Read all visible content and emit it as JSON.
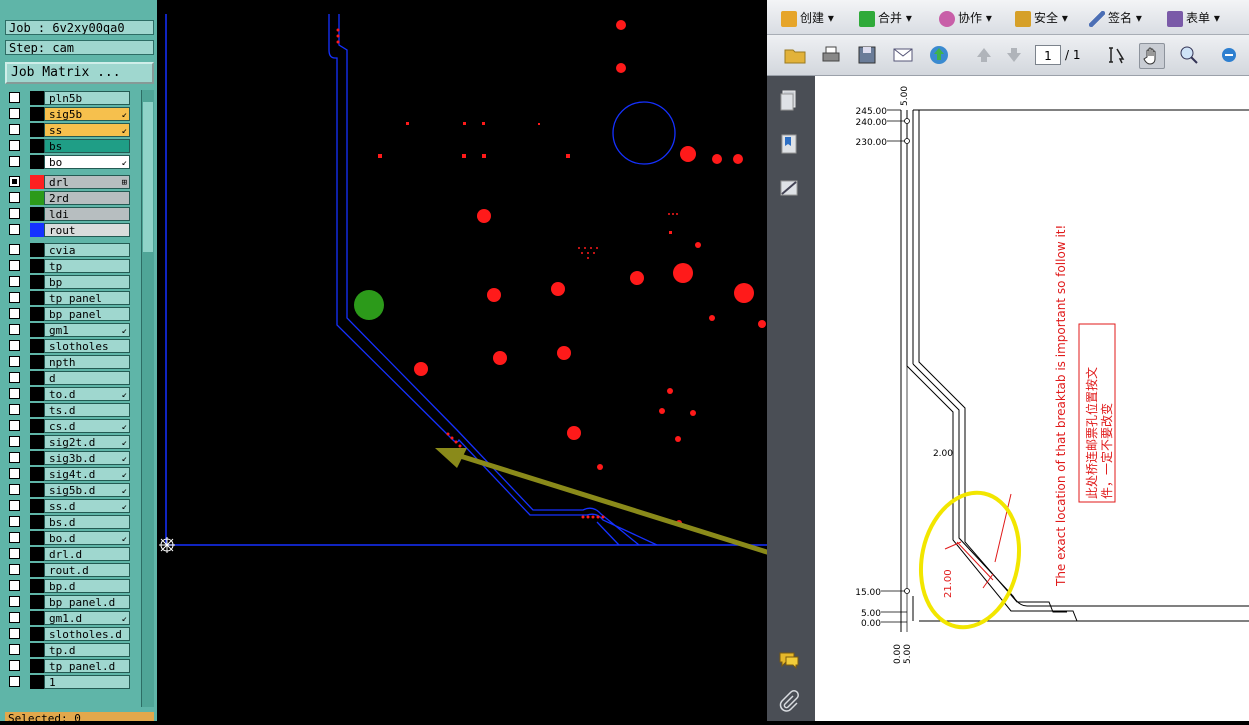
{
  "cam": {
    "job_line": "Job : 6v2xy00qa0",
    "step_line": "Step: cam",
    "job_matrix_label": "Job Matrix ...",
    "bottom_status": "Selected: 0",
    "layers": [
      {
        "name": "pln5b",
        "checked": false,
        "swatch": "#000000",
        "bg": "#9fd7cf",
        "mark": ""
      },
      {
        "name": "sig5b",
        "checked": false,
        "swatch": "#000000",
        "bg": "#f6c04d",
        "mark": "↙"
      },
      {
        "name": "ss",
        "checked": false,
        "swatch": "#000000",
        "bg": "#f6c04d",
        "mark": "↙"
      },
      {
        "name": "bs",
        "checked": false,
        "swatch": "#000000",
        "bg": "#1f9e86",
        "mark": ""
      },
      {
        "name": "bo",
        "checked": false,
        "swatch": "#000000",
        "bg": "#ffffff",
        "mark": "↙"
      },
      {
        "name": "drl",
        "checked": true,
        "swatch": "#ff2020",
        "bg": "#b7bec0",
        "mark": "⊞",
        "gap": true
      },
      {
        "name": "2rd",
        "checked": false,
        "swatch": "#2c9a1a",
        "bg": "#b7bec0",
        "mark": ""
      },
      {
        "name": "ldi",
        "checked": false,
        "swatch": "#000000",
        "bg": "#b7bec0",
        "mark": ""
      },
      {
        "name": "rout",
        "checked": false,
        "swatch": "#1531ff",
        "bg": "#d9dcdc",
        "mark": ""
      },
      {
        "name": "cvia",
        "checked": false,
        "swatch": "#000000",
        "bg": "#9fd7cf",
        "mark": "",
        "gap": true
      },
      {
        "name": "tp",
        "checked": false,
        "swatch": "#000000",
        "bg": "#9fd7cf",
        "mark": ""
      },
      {
        "name": "bp",
        "checked": false,
        "swatch": "#000000",
        "bg": "#9fd7cf",
        "mark": ""
      },
      {
        "name": "tp_panel",
        "checked": false,
        "swatch": "#000000",
        "bg": "#9fd7cf",
        "mark": ""
      },
      {
        "name": "bp_panel",
        "checked": false,
        "swatch": "#000000",
        "bg": "#9fd7cf",
        "mark": ""
      },
      {
        "name": "gm1",
        "checked": false,
        "swatch": "#000000",
        "bg": "#9fd7cf",
        "mark": "↙"
      },
      {
        "name": "slotholes",
        "checked": false,
        "swatch": "#000000",
        "bg": "#9fd7cf",
        "mark": ""
      },
      {
        "name": "npth",
        "checked": false,
        "swatch": "#000000",
        "bg": "#9fd7cf",
        "mark": ""
      },
      {
        "name": "d",
        "checked": false,
        "swatch": "#000000",
        "bg": "#9fd7cf",
        "mark": ""
      },
      {
        "name": "to.d",
        "checked": false,
        "swatch": "#000000",
        "bg": "#9fd7cf",
        "mark": "↙"
      },
      {
        "name": "ts.d",
        "checked": false,
        "swatch": "#000000",
        "bg": "#9fd7cf",
        "mark": ""
      },
      {
        "name": "cs.d",
        "checked": false,
        "swatch": "#000000",
        "bg": "#9fd7cf",
        "mark": "↙"
      },
      {
        "name": "sig2t.d",
        "checked": false,
        "swatch": "#000000",
        "bg": "#9fd7cf",
        "mark": "↙"
      },
      {
        "name": "sig3b.d",
        "checked": false,
        "swatch": "#000000",
        "bg": "#9fd7cf",
        "mark": "↙"
      },
      {
        "name": "sig4t.d",
        "checked": false,
        "swatch": "#000000",
        "bg": "#9fd7cf",
        "mark": "↙"
      },
      {
        "name": "sig5b.d",
        "checked": false,
        "swatch": "#000000",
        "bg": "#9fd7cf",
        "mark": "↙"
      },
      {
        "name": "ss.d",
        "checked": false,
        "swatch": "#000000",
        "bg": "#9fd7cf",
        "mark": "↙"
      },
      {
        "name": "bs.d",
        "checked": false,
        "swatch": "#000000",
        "bg": "#9fd7cf",
        "mark": ""
      },
      {
        "name": "bo.d",
        "checked": false,
        "swatch": "#000000",
        "bg": "#9fd7cf",
        "mark": "↙"
      },
      {
        "name": "drl.d",
        "checked": false,
        "swatch": "#000000",
        "bg": "#9fd7cf",
        "mark": ""
      },
      {
        "name": "rout.d",
        "checked": false,
        "swatch": "#000000",
        "bg": "#9fd7cf",
        "mark": ""
      },
      {
        "name": "bp.d",
        "checked": false,
        "swatch": "#000000",
        "bg": "#9fd7cf",
        "mark": ""
      },
      {
        "name": "bp_panel.d",
        "checked": false,
        "swatch": "#000000",
        "bg": "#9fd7cf",
        "mark": ""
      },
      {
        "name": "gm1.d",
        "checked": false,
        "swatch": "#000000",
        "bg": "#9fd7cf",
        "mark": "↙"
      },
      {
        "name": "slotholes.d",
        "checked": false,
        "swatch": "#000000",
        "bg": "#9fd7cf",
        "mark": ""
      },
      {
        "name": "tp.d",
        "checked": false,
        "swatch": "#000000",
        "bg": "#9fd7cf",
        "mark": ""
      },
      {
        "name": "tp_panel.d",
        "checked": false,
        "swatch": "#000000",
        "bg": "#9fd7cf",
        "mark": ""
      },
      {
        "name": "1",
        "checked": false,
        "swatch": "#000000",
        "bg": "#9fd7cf",
        "mark": ""
      }
    ]
  },
  "pdf": {
    "toolbar": {
      "create": "创建",
      "merge": "合并",
      "collaborate": "协作",
      "secure": "安全",
      "sign": "签名",
      "forms": "表单"
    },
    "page_number": "1",
    "page_total": "/ 1",
    "drawing": {
      "y_labels": [
        "245.00",
        "240.00",
        "230.00",
        "2.00",
        "15.00",
        "5.00",
        "0.00"
      ],
      "x_labels": [
        "0.00",
        "5.00"
      ],
      "top_label": "5.00",
      "dim_label": "21.00",
      "note_en": "The exact location of that breaktab is important so follow it!",
      "note_cn_line1": "此处桥连邮票孔位置按文",
      "note_cn_line2": "件，一定不要改变"
    }
  },
  "colors": {
    "cam_bg": "#000000",
    "rout": "#1531ff",
    "drill": "#ff1a1a",
    "green_pad": "#2c9a1a",
    "arrow": "#8a8a1a",
    "highlight": "#f2e600",
    "note_red": "#e01a1a"
  }
}
